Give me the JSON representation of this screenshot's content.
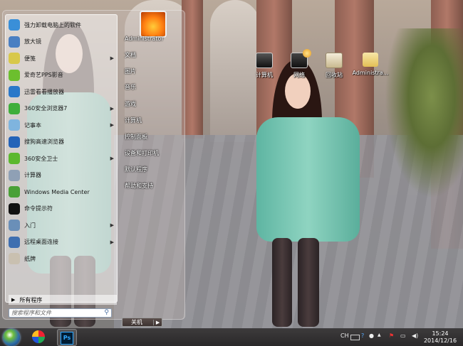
{
  "start_menu": {
    "programs": [
      {
        "label": "强力卸载电脑上的软件",
        "icon": "uninstall-icon",
        "color": "#3a8fd8",
        "has_arrow": false
      },
      {
        "label": "放大镜",
        "icon": "magnifier-icon",
        "color": "#4a7fc2",
        "has_arrow": false
      },
      {
        "label": "便笺",
        "icon": "sticky-notes-icon",
        "color": "#d8c84a",
        "has_arrow": true
      },
      {
        "label": "爱奇艺PPS影音",
        "icon": "pps-player-icon",
        "color": "#6cbf2e",
        "has_arrow": false
      },
      {
        "label": "迅雷看看播放器",
        "icon": "xunlei-player-icon",
        "color": "#2a78c9",
        "has_arrow": false
      },
      {
        "label": "360安全浏览器7",
        "icon": "360-browser-icon",
        "color": "#3fae3a",
        "has_arrow": true
      },
      {
        "label": "记事本",
        "icon": "notepad-icon",
        "color": "#7fb4de",
        "has_arrow": true
      },
      {
        "label": "搜狗高速浏览器",
        "icon": "sogou-browser-icon",
        "color": "#2463b8",
        "has_arrow": false
      },
      {
        "label": "360安全卫士",
        "icon": "360-safe-icon",
        "color": "#5cb82e",
        "has_arrow": true
      },
      {
        "label": "计算器",
        "icon": "calculator-icon",
        "color": "#8fa0b5",
        "has_arrow": false
      },
      {
        "label": "Windows Media Center",
        "icon": "media-center-icon",
        "color": "#4aa037",
        "has_arrow": false
      },
      {
        "label": "命令提示符",
        "icon": "cmd-icon",
        "color": "#111111",
        "has_arrow": false
      },
      {
        "label": "入门",
        "icon": "getting-started-icon",
        "color": "#6a8fb8",
        "has_arrow": true
      },
      {
        "label": "远程桌面连接",
        "icon": "remote-desktop-icon",
        "color": "#3f6fb0",
        "has_arrow": true
      },
      {
        "label": "纸牌",
        "icon": "solitaire-icon",
        "color": "#c9c0b0",
        "has_arrow": false
      }
    ],
    "all_programs": "所有程序",
    "search_placeholder": "搜索程序和文件",
    "username": "Administrator",
    "right_items": [
      "文档",
      "图片",
      "音乐",
      "游戏",
      "计算机",
      "控制面板",
      "设备和打印机",
      "默认程序",
      "帮助和支持"
    ],
    "shutdown_label": "关机"
  },
  "desktop_icons": [
    {
      "label": "计算机",
      "icon": "computer-icon"
    },
    {
      "label": "网络",
      "icon": "network-icon"
    },
    {
      "label": "回收站",
      "icon": "recycle-bin-icon"
    },
    {
      "label": "Administra...",
      "icon": "user-folder-icon"
    }
  ],
  "taskbar": {
    "pinned": [
      {
        "name": "pinwheel-app-icon"
      },
      {
        "name": "photoshop-icon",
        "text": "Ps"
      }
    ],
    "tray_ime": "CH",
    "clock_time": "15:24",
    "clock_date": "2014/12/16"
  }
}
